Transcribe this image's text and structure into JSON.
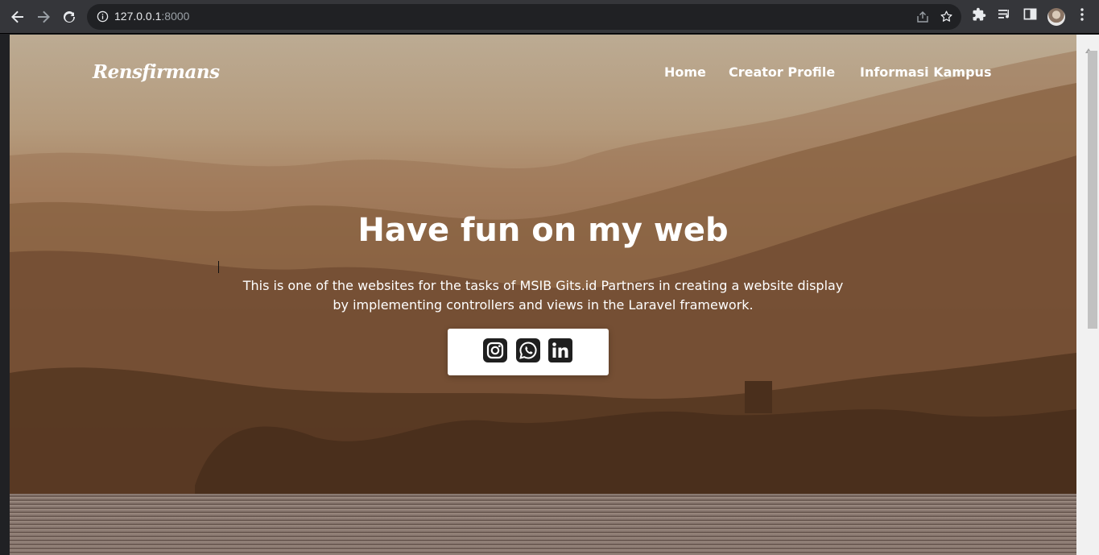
{
  "browser": {
    "url_host": "127.0.0.1",
    "url_port": ":8000",
    "icons": [
      "back-arrow-icon",
      "forward-arrow-icon",
      "reload-icon",
      "info-icon",
      "share-icon",
      "star-icon",
      "extensions-icon",
      "reading-list-icon",
      "side-panel-icon",
      "profile-avatar",
      "menu-kebab-icon"
    ]
  },
  "site": {
    "brand": "Rensfirmans",
    "nav": [
      "Home",
      "Creator Profile",
      "Informasi Kampus"
    ]
  },
  "hero": {
    "title": "Have fun on my web",
    "description": "This is one of the websites for the tasks of MSIB Gits.id Partners in creating a website display by implementing controllers and views in the Laravel framework.",
    "social_icons": [
      "instagram-icon",
      "whatsapp-icon",
      "linkedin-icon"
    ]
  },
  "colors": {
    "chrome_bg": "#35363a",
    "omnibox_bg": "#202124",
    "hero_text": "#ffffff",
    "icon_dark": "#1f1f1f"
  }
}
